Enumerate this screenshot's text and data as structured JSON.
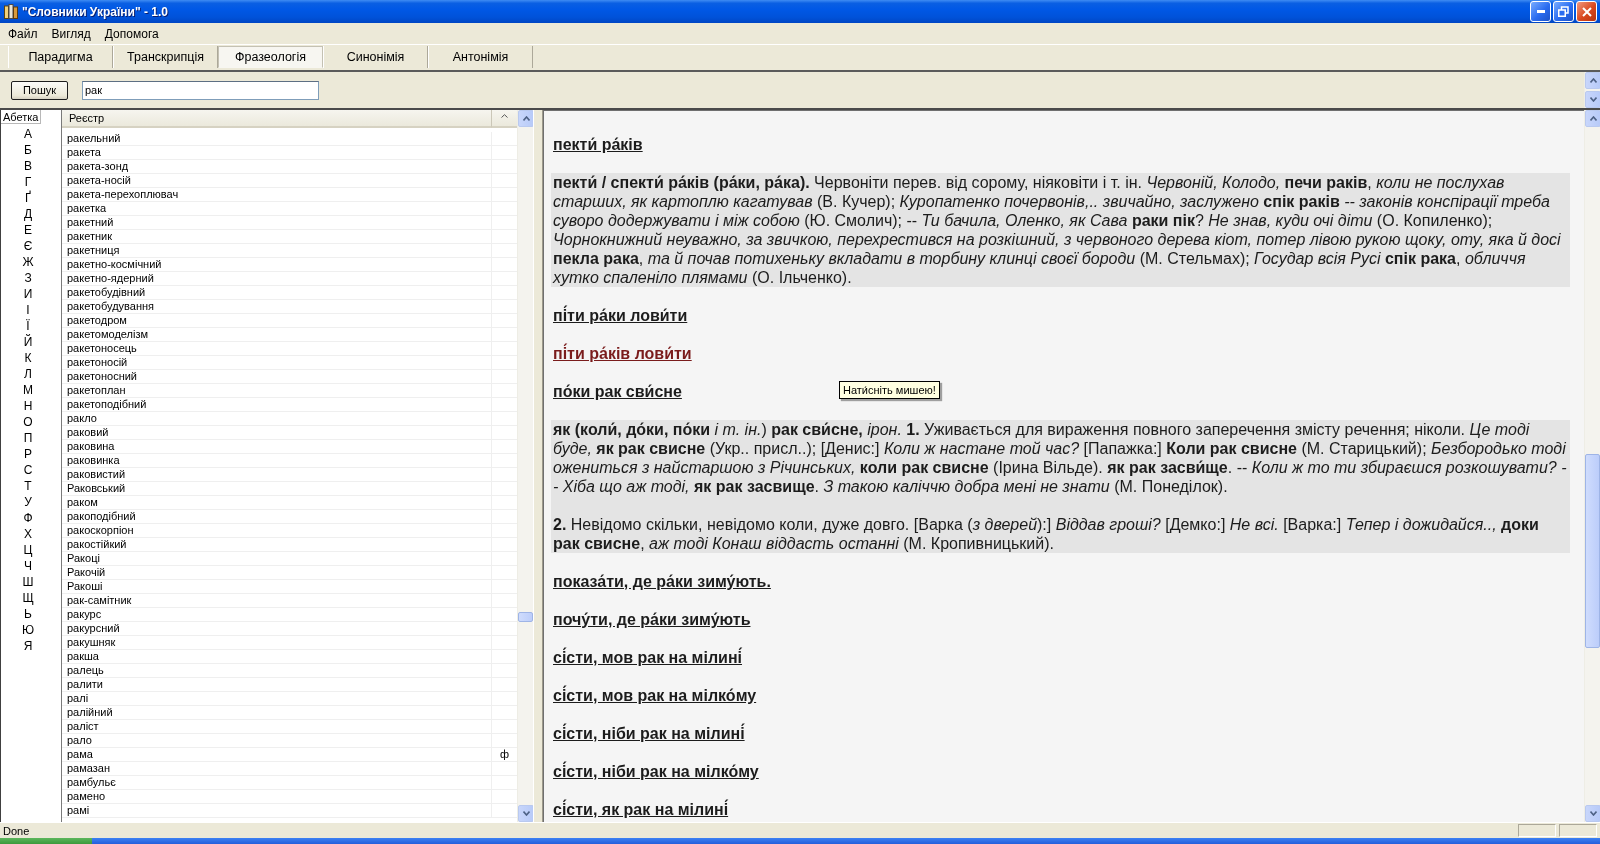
{
  "window": {
    "title": "\"Словники України\" - 1.0"
  },
  "menu": [
    "Файл",
    "Вигляд",
    "Допомога"
  ],
  "tabs": [
    {
      "label": "Парадигма",
      "selected": false
    },
    {
      "label": "Транскрипція",
      "selected": false
    },
    {
      "label": "Фразеологія",
      "selected": true
    },
    {
      "label": "Синонімія",
      "selected": false
    },
    {
      "label": "Антонімія",
      "selected": false
    }
  ],
  "search": {
    "button": "Пошук",
    "value": "рак"
  },
  "alphabet": {
    "title": "Абетка",
    "letters": [
      "А",
      "Б",
      "В",
      "Г",
      "Ґ",
      "Д",
      "Е",
      "Є",
      "Ж",
      "З",
      "И",
      "І",
      "Ї",
      "Й",
      "К",
      "Л",
      "М",
      "Н",
      "О",
      "П",
      "Р",
      "С",
      "Т",
      "У",
      "Ф",
      "Х",
      "Ц",
      "Ч",
      "Ш",
      "Щ",
      "Ь",
      "Ю",
      "Я"
    ]
  },
  "register": {
    "column": "Реєстр",
    "rows": [
      {
        "word": "ракельний"
      },
      {
        "word": "ракета"
      },
      {
        "word": "ракета-зонд"
      },
      {
        "word": "ракета-носій"
      },
      {
        "word": "ракета-перехоплювач"
      },
      {
        "word": "ракетка"
      },
      {
        "word": "ракетний"
      },
      {
        "word": "ракетник"
      },
      {
        "word": "ракетниця"
      },
      {
        "word": "ракетно-космічний"
      },
      {
        "word": "ракетно-ядерний"
      },
      {
        "word": "ракетобудівний"
      },
      {
        "word": "ракетобудування"
      },
      {
        "word": "ракетодром"
      },
      {
        "word": "ракетомоделізм"
      },
      {
        "word": "ракетоносець"
      },
      {
        "word": "ракетоносій"
      },
      {
        "word": "ракетоносний"
      },
      {
        "word": "ракетоплан"
      },
      {
        "word": "ракетоподібний"
      },
      {
        "word": "ракло"
      },
      {
        "word": "раковий"
      },
      {
        "word": "раковина"
      },
      {
        "word": "раковинка"
      },
      {
        "word": "раковистий"
      },
      {
        "word": "Раковський"
      },
      {
        "word": "раком"
      },
      {
        "word": "ракоподібний"
      },
      {
        "word": "ракоскорпіон"
      },
      {
        "word": "ракостійкий"
      },
      {
        "word": "Ракоці"
      },
      {
        "word": "Ракочій"
      },
      {
        "word": "Ракоші"
      },
      {
        "word": "рак-самітник"
      },
      {
        "word": "ракурс"
      },
      {
        "word": "ракурсний"
      },
      {
        "word": "ракушняк"
      },
      {
        "word": "ракша"
      },
      {
        "word": "ралець"
      },
      {
        "word": "ралити"
      },
      {
        "word": "ралі"
      },
      {
        "word": "ралійний"
      },
      {
        "word": "раліст"
      },
      {
        "word": "рало"
      },
      {
        "word": "рама",
        "column_2": "ф"
      },
      {
        "word": "рамазан"
      },
      {
        "word": "рамбульє"
      },
      {
        "word": "рамено"
      },
      {
        "word": "рамі"
      }
    ]
  },
  "article": {
    "entries": [
      {
        "kind": "heading",
        "text": "пекти́ ра́ків",
        "visited": false
      },
      {
        "kind": "definition",
        "paragraphs": [
          "**пекти́ / спекти́ ра́ків (ра́ки, ра́ка).** Червоніти перев. від сорому, ніяковіти і т. ін. *Червоній, Колодо,* **печи раків**, *коли не послухав старших, як картоплю кагатував* (В. Кучер); *Куропатенко почервонів,.. звичайно, заслужено* **спік раків** *-- законів конспірації треба суворо додержувати і між собою* (Ю. Смолич); -- *Ти бачила, Оленко, як Сава* **раки пік**? *Не знав, куди очі діти* (О. Копиленко); *Чорнокнижний неуважно, за звичкою, перехрестився на розкішний, з червоного дерева кіот, потер лівою рукою щоку, оту, яка й досі* **пекла рака**, *та й почав потихеньку вкладати в торбину клинці своєї бороди* (М. Стельмах); *Государ всія Русі* **спік рака**, *обличчя хутко спаленіло плямами* (О. Ільченко)."
        ]
      },
      {
        "kind": "heading",
        "text": "пі́ти ра́ки лови́ти",
        "visited": false
      },
      {
        "kind": "heading",
        "text": "пі́ти ра́ків лови́ти",
        "visited": true
      },
      {
        "kind": "heading",
        "text": "по́ки рак сви́сне",
        "visited": false
      },
      {
        "kind": "definition",
        "paragraphs": [
          "**як (коли́, до́ки, по́ки** *і т. ін.*) **рак сви́сне,** *ірон.* **1.** Уживається для вираження повного заперечення змісту речення; ніколи. *Це тоді буде,* **як рак свисне** (Укр.. присл..); [Денис:] *Коли ж настане той час?* [Папажка:] **Коли рак свисне** (М. Старицький); *Безбородько тоді ожениться з найстаршою з Річинських,* **коли рак свисне** (Ірина Вільде). **як рак засви́ще**. -- *Коли ж то ти збираєшся розкошувати? -- Хіба що аж тоді,* **як рак засвище**. *З такою каліччю добра мені не знати* (М. Понеділок).",
          "**2.** Невідомо скільки, невідомо коли, дуже довго. [Варка (*з дверей*):] *Віддав гроші?* [Демко:] *Не всі.* [Варка:] *Тепер і дожидайся..,* **доки рак свисне**, *аж тоді Конаш віддасть останні* (М. Кропивницький)."
        ]
      },
      {
        "kind": "heading",
        "text": "показа́ти, де ра́ки зиму́ють.",
        "visited": false
      },
      {
        "kind": "heading",
        "text": "почу́ти, де ра́ки зиму́ють",
        "visited": false
      },
      {
        "kind": "heading",
        "text": "сі́сти, мов рак на мілині́",
        "visited": false
      },
      {
        "kind": "heading",
        "text": "сі́сти, мов рак на мілко́му",
        "visited": false
      },
      {
        "kind": "heading",
        "text": "сі́сти, ніби рак на мілині́",
        "visited": false
      },
      {
        "kind": "heading",
        "text": "сі́сти, ніби рак на мілко́му",
        "visited": false
      },
      {
        "kind": "heading",
        "text": "сі́сти, як рак на мілині́",
        "visited": false
      }
    ]
  },
  "tooltip": {
    "text": "Нати́сніть мишею!"
  },
  "status_bar": {
    "text": "Done"
  }
}
